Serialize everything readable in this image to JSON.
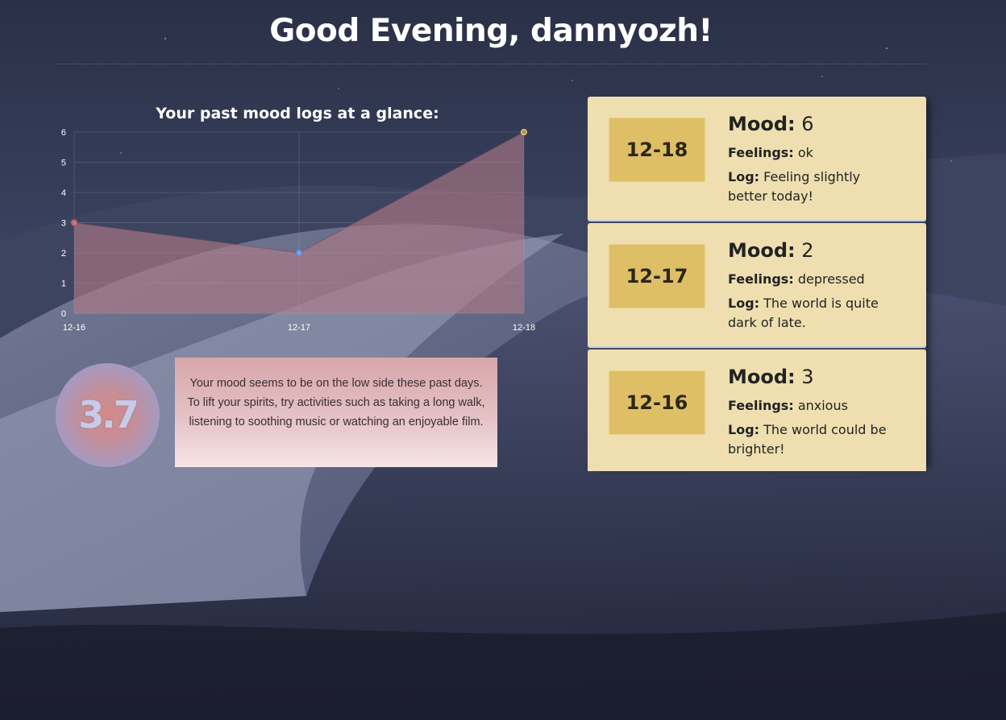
{
  "header": {
    "greeting": "Good Evening, dannyozh!"
  },
  "chart_title": "Your past mood logs at a glance:",
  "chart_data": {
    "type": "area",
    "categories": [
      "12-16",
      "12-17",
      "12-18"
    ],
    "values": [
      3,
      2,
      6
    ],
    "point_colors": [
      "#d9605f",
      "#5b8ff0",
      "#e8c24a"
    ],
    "fill_color": "#b07a88",
    "ylim": [
      0,
      6
    ],
    "yticks": [
      0,
      1,
      2,
      3,
      4,
      5,
      6
    ],
    "grid": true,
    "legend": "none"
  },
  "average": {
    "value": "3.7"
  },
  "advice": {
    "line1": "Your mood seems to be on the low side these past days.",
    "line2": "To lift your spirits, try activities such as taking a long walk,",
    "line3": "listening to soothing music or watching an enjoyable film."
  },
  "logs": [
    {
      "date": "12-18",
      "mood_label": "Mood:",
      "mood": "6",
      "feelings_label": "Feelings:",
      "feelings": "ok",
      "log_label": "Log:",
      "log": "Feeling slightly better today!"
    },
    {
      "date": "12-17",
      "mood_label": "Mood:",
      "mood": "2",
      "feelings_label": "Feelings:",
      "feelings": "depressed",
      "log_label": "Log:",
      "log": "The world is quite dark of late."
    },
    {
      "date": "12-16",
      "mood_label": "Mood:",
      "mood": "3",
      "feelings_label": "Feelings:",
      "feelings": "anxious",
      "log_label": "Log:",
      "log": "The world could be brighter!"
    }
  ],
  "colors": {
    "card_bg": "#efdfb0",
    "date_box": "#dfbf66",
    "background": "#2b3147"
  }
}
